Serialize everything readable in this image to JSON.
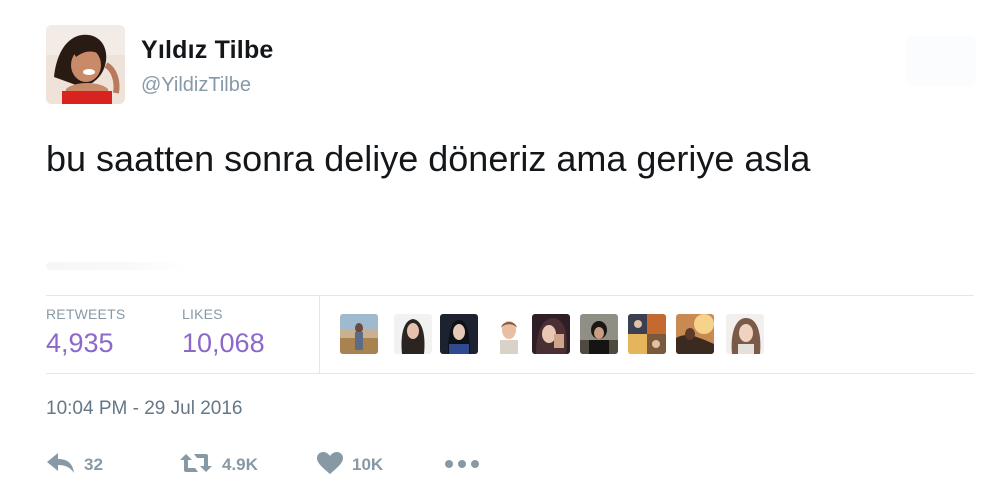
{
  "author": {
    "display_name": "Yıldız Tilbe",
    "handle": "@YildizTilbe"
  },
  "tweet": {
    "text": "bu saatten sonra deliye döneriz ama geriye asla"
  },
  "stats": {
    "retweets_label": "RETWEETS",
    "retweets_value": "4,935",
    "likes_label": "LIKES",
    "likes_value": "10,068"
  },
  "likers": [
    {
      "icon": "liker-avatar-1"
    },
    {
      "icon": "liker-avatar-2"
    },
    {
      "icon": "liker-avatar-3"
    },
    {
      "icon": "liker-avatar-4"
    },
    {
      "icon": "liker-avatar-5"
    },
    {
      "icon": "liker-avatar-6"
    },
    {
      "icon": "liker-avatar-7"
    },
    {
      "icon": "liker-avatar-8"
    },
    {
      "icon": "liker-avatar-9"
    }
  ],
  "timestamp": "10:04 PM - 29 Jul 2016",
  "actions": {
    "reply_count": "32",
    "retweet_count": "4.9K",
    "like_count": "10K",
    "icons": {
      "reply": "reply-icon",
      "retweet": "retweet-icon",
      "like": "heart-icon",
      "more": "more-icon"
    }
  },
  "colors": {
    "text": "#14171a",
    "muted": "#8899a6",
    "accent_purple": "#8b68c9",
    "divider": "#e1e8ed"
  }
}
